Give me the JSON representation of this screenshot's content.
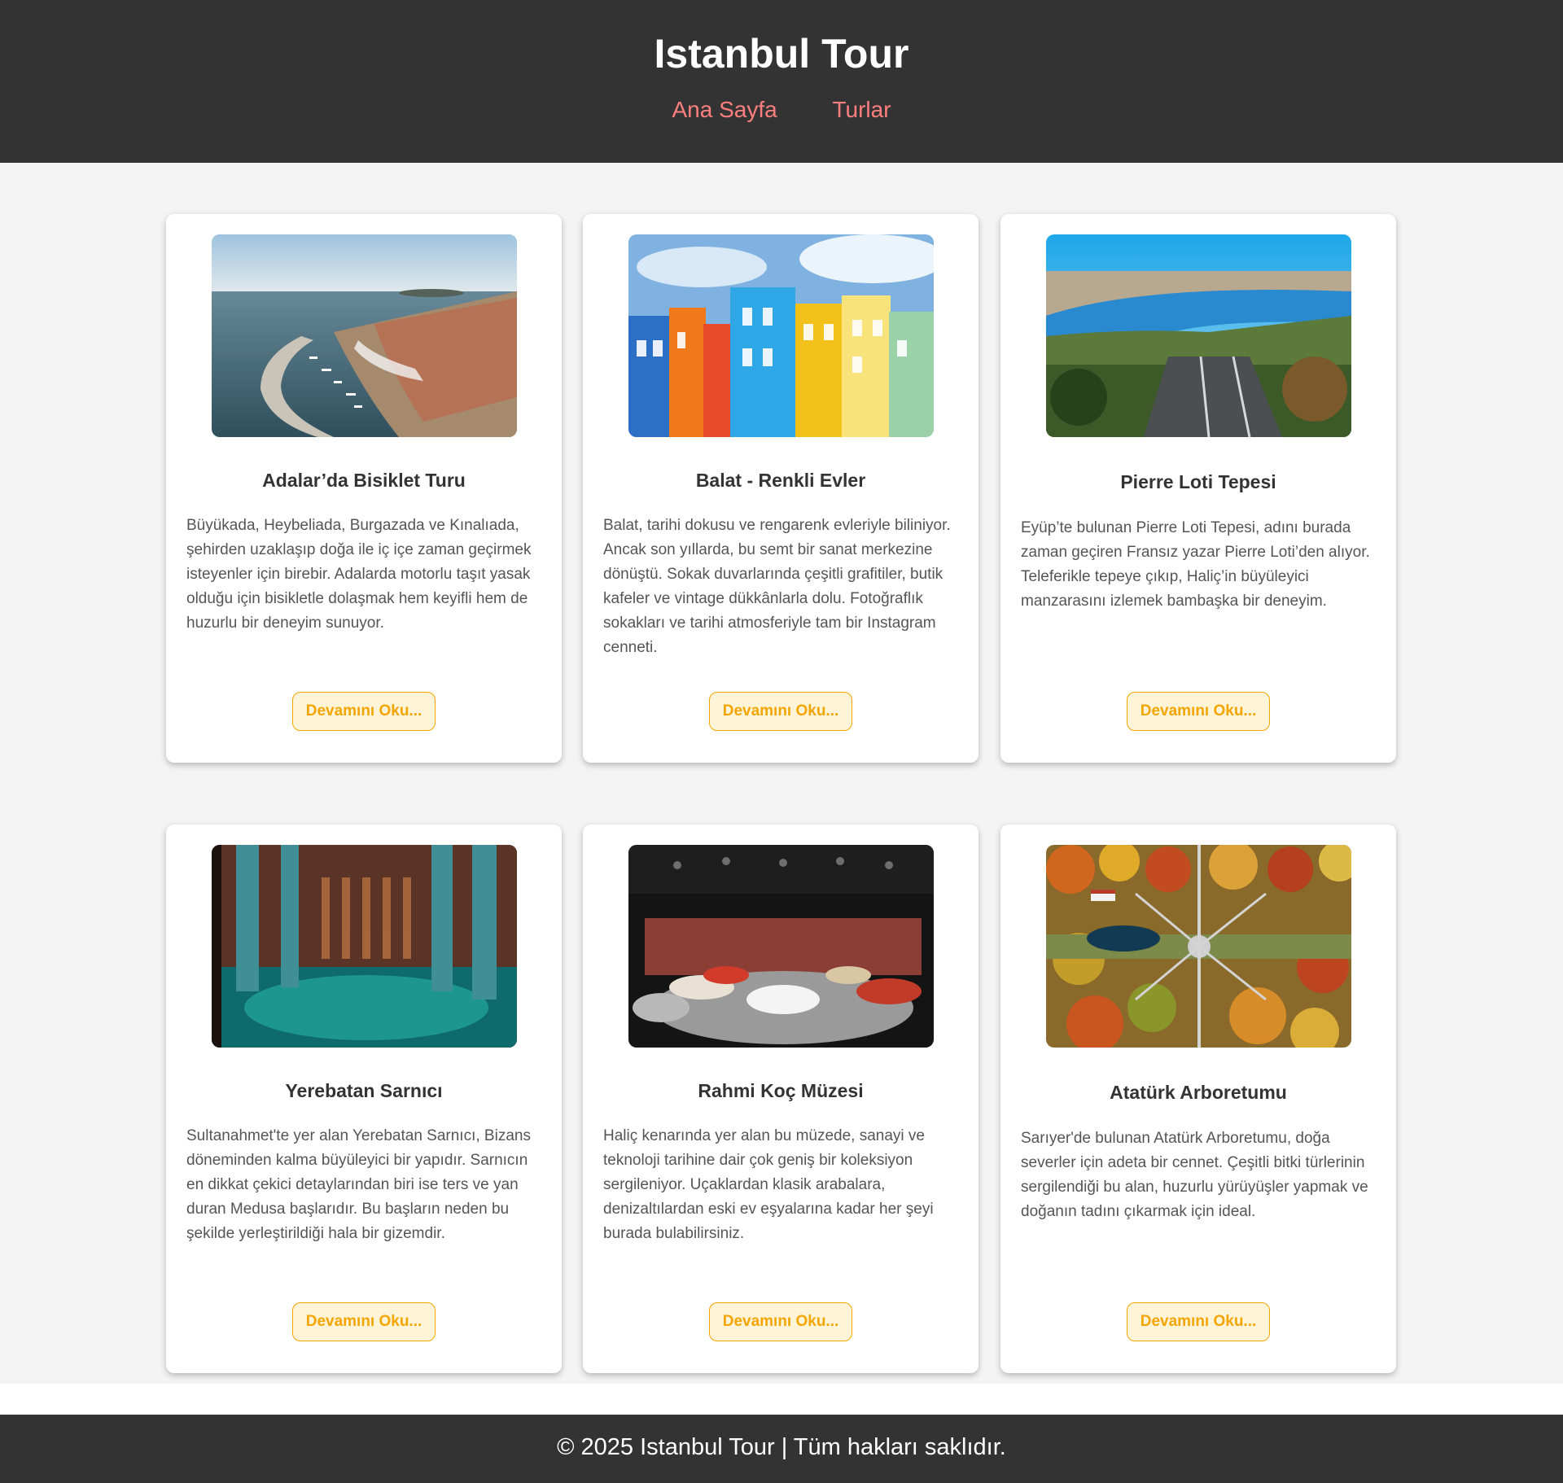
{
  "header": {
    "title": "Istanbul Tour",
    "nav": [
      {
        "label": "Ana Sayfa"
      },
      {
        "label": "Turlar"
      }
    ]
  },
  "tours": [
    {
      "title": "Adalar’da Bisiklet Turu",
      "description": "Büyükada, Heybeliada, Burgazada ve Kınalıada, şehirden uzaklaşıp doğa ile iç içe zaman geçirmek isteyenler için birebir. Adalarda motorlu taşıt yasak olduğu için bisikletle dolaşmak hem keyifli hem de huzurlu bir deneyim sunuyor.",
      "button": "Devamını Oku...",
      "image": "island-harbor-aerial-photo"
    },
    {
      "title": "Balat - Renkli Evler",
      "description": "Balat, tarihi dokusu ve rengarenk evleriyle biliniyor. Ancak son yıllarda, bu semt bir sanat merkezine dönüştü. Sokak duvarlarında çeşitli grafitiler, butik kafeler ve vintage dükkânlarla dolu. Fotoğraflık sokakları ve tarihi atmosferiyle tam bir Instagram cenneti.",
      "button": "Devamını Oku...",
      "image": "colorful-houses-photo"
    },
    {
      "title": "Pierre Loti Tepesi",
      "description": "Eyüp’te bulunan Pierre Loti Tepesi, adını burada zaman geçiren Fransız yazar Pierre Loti’den alıyor. Teleferikle tepeye çıkıp, Haliç’in büyüleyici manzarasını izlemek bambaşka bir deneyim.",
      "button": "Devamını Oku...",
      "image": "golden-horn-cable-car-photo"
    },
    {
      "title": "Yerebatan Sarnıcı",
      "description": "Sultanahmet'te yer alan Yerebatan Sarnıcı, Bizans döneminden kalma büyüleyici bir yapıdır. Sarnıcın en dikkat çekici detaylarından biri ise ters ve yan duran Medusa başlarıdır. Bu başların neden bu şekilde yerleştirildiği hala bir gizemdir.",
      "button": "Devamını Oku...",
      "image": "cistern-columns-photo"
    },
    {
      "title": "Rahmi Koç Müzesi",
      "description": "Haliç kenarında yer alan bu müzede, sanayi ve teknoloji tarihine dair çok geniş bir koleksiyon sergileniyor. Uçaklardan klasik arabalara, denizaltılardan eski ev eşyalarına kadar her şeyi burada bulabilirsiniz.",
      "button": "Devamını Oku...",
      "image": "museum-classic-cars-photo"
    },
    {
      "title": "Atatürk Arboretumu",
      "description": "Sarıyer'de bulunan Atatürk Arboretumu, doğa severler için adeta bir cennet. Çeşitli bitki türlerinin sergilendiği bu alan, huzurlu yürüyüşler yapmak ve doğanın tadını çıkarmak için ideal.",
      "button": "Devamını Oku...",
      "image": "autumn-arboretum-aerial-photo"
    }
  ],
  "footer": {
    "text": "© 2025 Istanbul Tour | Tüm hakları saklıdır."
  },
  "colors": {
    "header_bg": "#333333",
    "nav_link": "#ff7f7f",
    "page_bg": "#f4f4f4",
    "button_text": "#f5a500",
    "button_bg": "#fff4d8"
  }
}
